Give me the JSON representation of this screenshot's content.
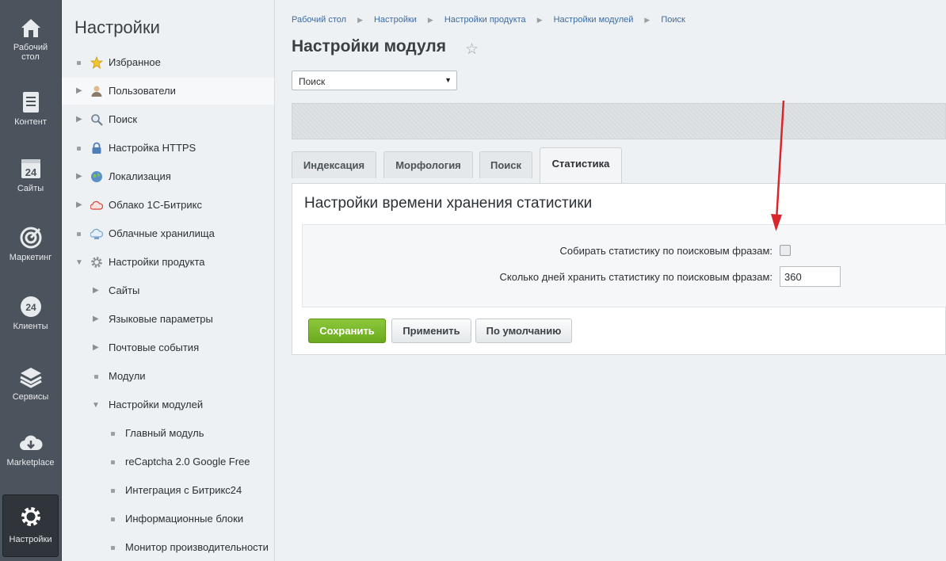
{
  "rail": {
    "items": [
      {
        "label": "Рабочий стол",
        "icon": "home-icon"
      },
      {
        "label": "Контент",
        "icon": "document-icon"
      },
      {
        "label": "Сайты",
        "icon": "calendar-24-icon"
      },
      {
        "label": "Маркетинг",
        "icon": "target-icon"
      },
      {
        "label": "Клиенты",
        "icon": "clients-24-icon"
      },
      {
        "label": "Сервисы",
        "icon": "layers-icon"
      },
      {
        "label": "Marketplace",
        "icon": "cloud-download-icon"
      },
      {
        "label": "Настройки",
        "icon": "gear-icon",
        "active": true
      }
    ]
  },
  "menu": {
    "title": "Настройки",
    "items": [
      {
        "label": "Избранное",
        "icon": "star-icon"
      },
      {
        "label": "Пользователи",
        "icon": "user-icon"
      },
      {
        "label": "Поиск",
        "icon": "magnifier-icon"
      },
      {
        "label": "Настройка HTTPS",
        "icon": "lock-icon"
      },
      {
        "label": "Локализация",
        "icon": "globe-icon"
      },
      {
        "label": "Облако 1С-Битрикс",
        "icon": "cloud-icon"
      },
      {
        "label": "Облачные хранилища",
        "icon": "cloud-storage-icon"
      },
      {
        "label": "Настройки продукта",
        "icon": "gear-icon"
      },
      {
        "label": "Сайты"
      },
      {
        "label": "Языковые параметры"
      },
      {
        "label": "Почтовые события"
      },
      {
        "label": "Модули"
      },
      {
        "label": "Настройки модулей"
      },
      {
        "label": "Главный модуль"
      },
      {
        "label": "reCaptcha 2.0 Google Free"
      },
      {
        "label": "Интеграция с Битрикс24"
      },
      {
        "label": "Информационные блоки"
      },
      {
        "label": "Монитор производительности"
      }
    ]
  },
  "breadcrumb": [
    "Рабочий стол",
    "Настройки",
    "Настройки продукта",
    "Настройки модулей",
    "Поиск"
  ],
  "page": {
    "title": "Настройки модуля",
    "module_select": "Поиск"
  },
  "tabs": [
    "Индексация",
    "Морфология",
    "Поиск",
    "Статистика"
  ],
  "panel": {
    "title": "Настройки времени хранения статистики",
    "collect_label": "Собирать статистику по поисковым фразам:",
    "collect_checked": false,
    "days_label": "Сколько дней хранить статистику по поисковым фразам:",
    "days_value": "360"
  },
  "buttons": {
    "save": "Сохранить",
    "apply": "Применить",
    "default": "По умолчанию"
  },
  "colors": {
    "rail": "#4b535c",
    "accent_green": "#7cb92b",
    "link": "#3d6ba1",
    "annotation_arrow": "#d9262c"
  }
}
